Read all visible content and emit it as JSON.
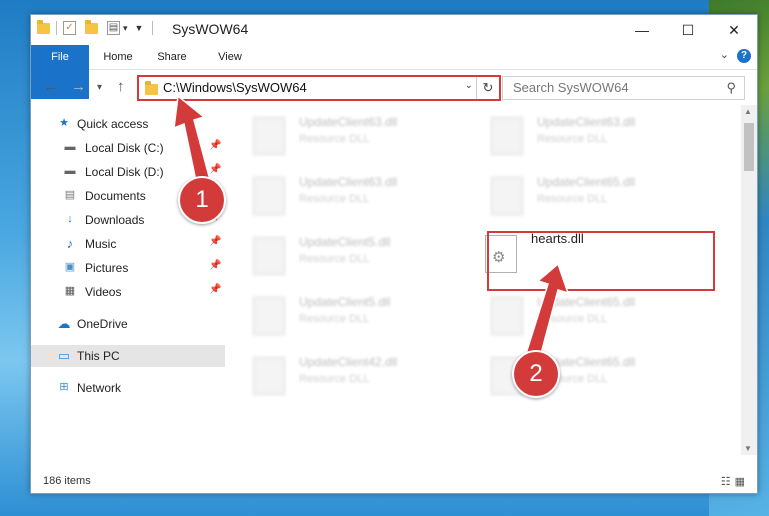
{
  "window": {
    "title": "SysWOW64",
    "minimize": "—",
    "maximize": "☐",
    "close": "✕"
  },
  "ribbon": {
    "tabs": [
      {
        "label": "File"
      },
      {
        "label": "Home"
      },
      {
        "label": "Share"
      },
      {
        "label": "View"
      }
    ],
    "help": "?"
  },
  "nav": {
    "back": "←",
    "forward": "→",
    "dropdown": "▾",
    "up": "↑",
    "address": "C:\\Windows\\SysWOW64",
    "refresh": "↻",
    "search_placeholder": "Search SysWOW64",
    "search_icon": "search-icon"
  },
  "sidebar": {
    "items": [
      {
        "label": "Quick access",
        "icon": "star-icon",
        "glyph": "★",
        "color": "#1a73c9"
      },
      {
        "label": "Local Disk (C:)",
        "icon": "drive-icon",
        "glyph": "▬",
        "color": "#666",
        "pinned": true
      },
      {
        "label": "Local Disk (D:)",
        "icon": "drive-icon",
        "glyph": "▬",
        "color": "#666",
        "pinned": true
      },
      {
        "label": "Documents",
        "icon": "documents-icon",
        "glyph": "▤",
        "color": "#777",
        "pinned": true
      },
      {
        "label": "Downloads",
        "icon": "download-icon",
        "glyph": "↓",
        "color": "#1a73c9",
        "pinned": true
      },
      {
        "label": "Music",
        "icon": "music-icon",
        "glyph": "♪",
        "color": "#1a73c9",
        "pinned": true
      },
      {
        "label": "Pictures",
        "icon": "pictures-icon",
        "glyph": "▣",
        "color": "#4a8fc6",
        "pinned": true
      },
      {
        "label": "Videos",
        "icon": "videos-icon",
        "glyph": "▦",
        "color": "#555",
        "pinned": true
      },
      {
        "label": "OneDrive",
        "icon": "cloud-icon",
        "glyph": "☁",
        "color": "#1a73c9"
      },
      {
        "label": "This PC",
        "icon": "computer-icon",
        "glyph": "▭",
        "color": "#3a8fd6",
        "selected": true
      },
      {
        "label": "Network",
        "icon": "network-icon",
        "glyph": "⊞",
        "color": "#3a8fd6"
      }
    ]
  },
  "files": [
    {
      "name": "UpdateClient63.dll",
      "desc": "Resource DLL",
      "blurred": true
    },
    {
      "name": "UpdateClient63.dll",
      "desc": "Resource DLL",
      "blurred": true
    },
    {
      "name": "UpdateClient63.dll",
      "desc": "Resource DLL",
      "blurred": true
    },
    {
      "name": "UpdateClient65.dll",
      "desc": "Resource DLL",
      "blurred": true
    },
    {
      "name": "UpdateClient5.dll",
      "desc": "Resource DLL",
      "blurred": true
    },
    {
      "name": "hearts.dll",
      "desc": "",
      "blurred": false
    },
    {
      "name": "UpdateClient5.dll",
      "desc": "Resource DLL",
      "blurred": true
    },
    {
      "name": "UpdateClient65.dll",
      "desc": "Resource DLL",
      "blurred": true
    },
    {
      "name": "UpdateClient42.dll",
      "desc": "Resource DLL",
      "blurred": true
    },
    {
      "name": "UpdateClient65.dll",
      "desc": "Resource DLL",
      "blurred": true
    }
  ],
  "status": {
    "count": "186 items"
  },
  "annotations": {
    "step1": "1",
    "step2": "2",
    "color": "#d33b3b"
  }
}
